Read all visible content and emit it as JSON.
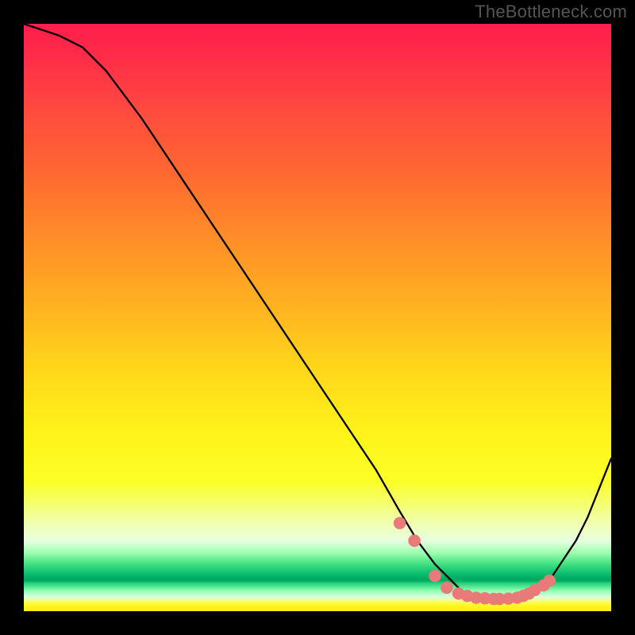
{
  "watermark": "TheBottleneck.com",
  "chart_data": {
    "type": "line",
    "title": "",
    "xlabel": "",
    "ylabel": "",
    "xlim": [
      0,
      100
    ],
    "ylim": [
      0,
      100
    ],
    "background_gradient": "rainbow_heatmap",
    "curve": {
      "x": [
        0,
        3,
        6,
        10,
        14,
        20,
        28,
        36,
        44,
        52,
        60,
        64,
        67,
        70,
        73,
        75,
        78,
        81,
        84,
        86,
        88,
        90,
        92,
        94,
        96,
        98,
        100
      ],
      "y": [
        100,
        99,
        98,
        96,
        92,
        84,
        72,
        60,
        48,
        36,
        24,
        17,
        12,
        8,
        5,
        3,
        2,
        2,
        2,
        3,
        4,
        6,
        9,
        12,
        16,
        21,
        26
      ]
    },
    "markers": {
      "x": [
        64,
        66.5,
        70,
        72,
        74,
        75.5,
        77,
        78.5,
        80,
        81,
        82.5,
        84,
        85,
        86,
        87,
        88.5,
        89.5
      ],
      "y": [
        15,
        12,
        6,
        4,
        3,
        2.6,
        2.3,
        2.2,
        2.1,
        2.1,
        2.15,
        2.3,
        2.6,
        3.0,
        3.6,
        4.4,
        5.2
      ]
    }
  },
  "colors": {
    "marker": "#e97a7a",
    "curve": "#000000"
  }
}
